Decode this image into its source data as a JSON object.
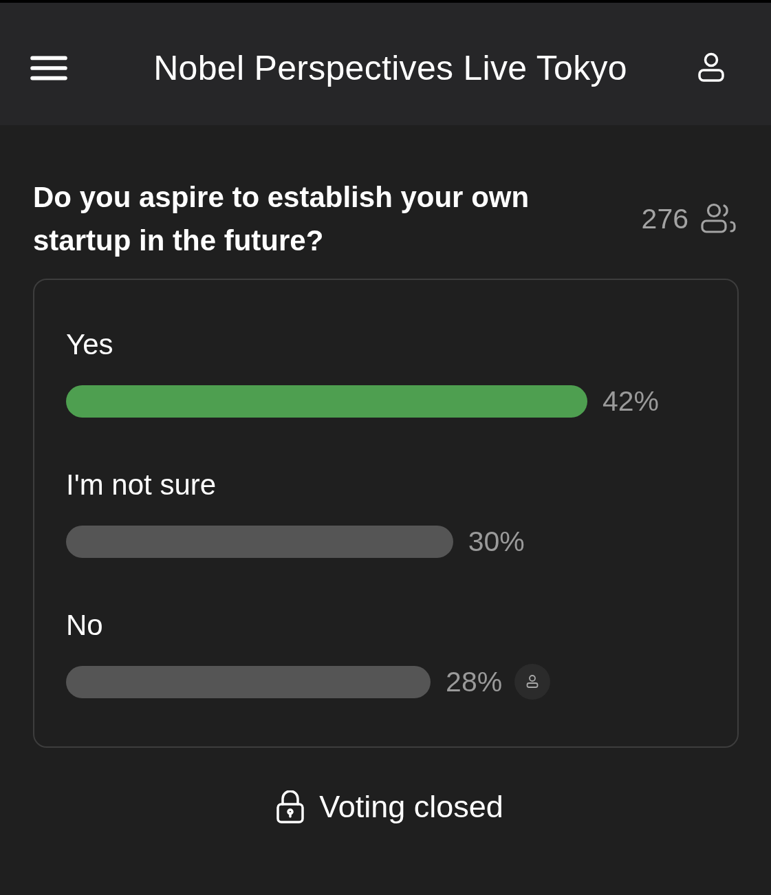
{
  "header": {
    "title": "Nobel Perspectives Live Tokyo"
  },
  "poll": {
    "question": "Do you aspire to establish your own startup in the future?",
    "participants": "276",
    "options": [
      {
        "label": "Yes",
        "level": 0.815,
        "percent": "42%",
        "leading": true,
        "my_vote": false
      },
      {
        "label": "I'm not sure",
        "level": 0.605,
        "percent": "30%",
        "leading": false,
        "my_vote": false
      },
      {
        "label": "No",
        "level": 0.57,
        "percent": "28%",
        "leading": false,
        "my_vote": true
      }
    ]
  },
  "status": {
    "label": "Voting closed",
    "locked": true
  }
}
